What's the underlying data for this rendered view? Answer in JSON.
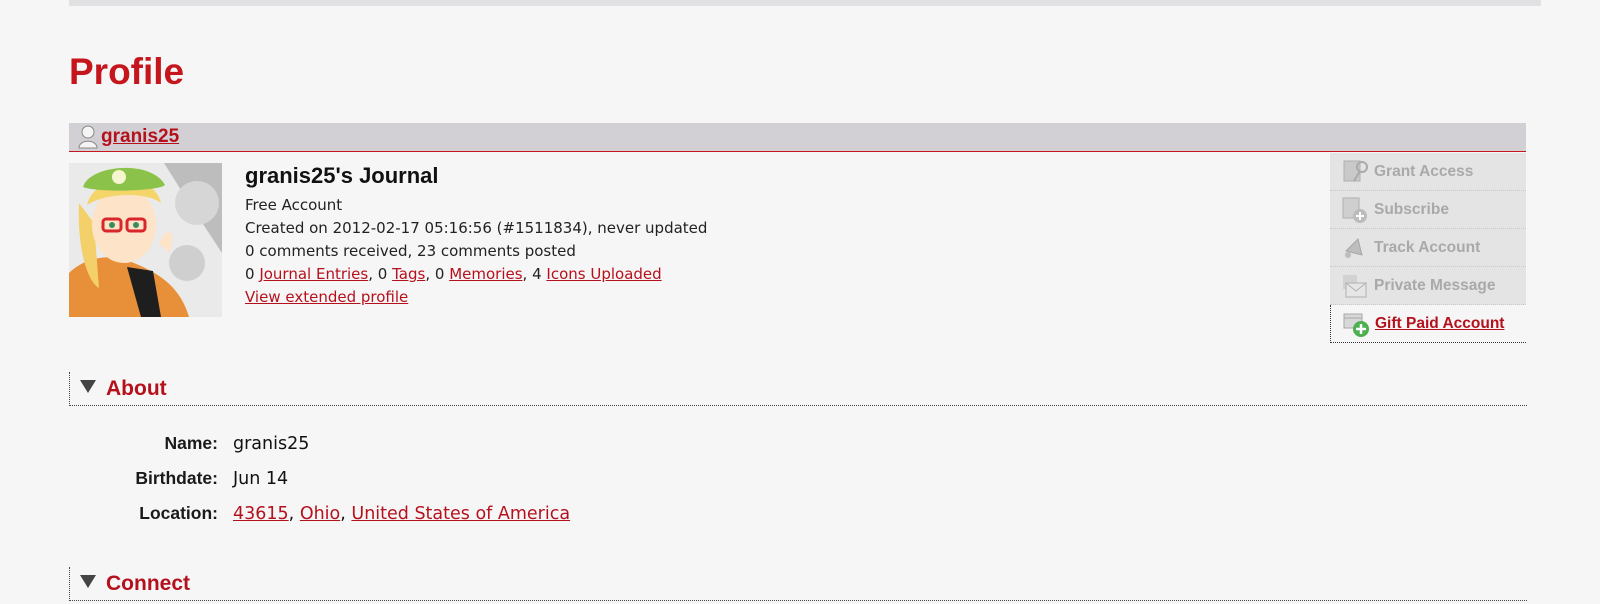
{
  "page": {
    "title": "Profile"
  },
  "user": {
    "name": "granis25"
  },
  "journal": {
    "title": "granis25's Journal",
    "account_type": "Free Account",
    "created": "Created on 2012-02-17 05:16:56 (#1511834), never updated",
    "comments": "0 comments received, 23 comments posted",
    "stats": {
      "entries_count": "0",
      "entries_label": "Journal Entries",
      "tags_count": "0",
      "tags_label": "Tags",
      "memories_count": "0",
      "memories_label": "Memories",
      "icons_count": "4",
      "icons_label": "Icons Uploaded"
    },
    "extended_link": "View extended profile"
  },
  "actions": [
    {
      "label": "Grant Access",
      "icon": "grant-access-icon",
      "enabled": false
    },
    {
      "label": "Subscribe",
      "icon": "subscribe-icon",
      "enabled": false
    },
    {
      "label": "Track Account",
      "icon": "track-icon",
      "enabled": false
    },
    {
      "label": "Private Message",
      "icon": "message-icon",
      "enabled": false
    },
    {
      "label": "Gift Paid Account",
      "icon": "gift-icon",
      "enabled": true
    }
  ],
  "about": {
    "heading": "About",
    "fields": {
      "name_key": "Name:",
      "name_val": "granis25",
      "birth_key": "Birthdate:",
      "birth_val": "Jun 14",
      "loc_key": "Location:",
      "loc_zip": "43615",
      "loc_state": "Ohio",
      "loc_country": "United States of America"
    }
  },
  "connect": {
    "heading": "Connect"
  },
  "colors": {
    "accent": "#c4161c",
    "header_bg": "#d2d0d4",
    "page_bg": "#f6f6f6"
  }
}
